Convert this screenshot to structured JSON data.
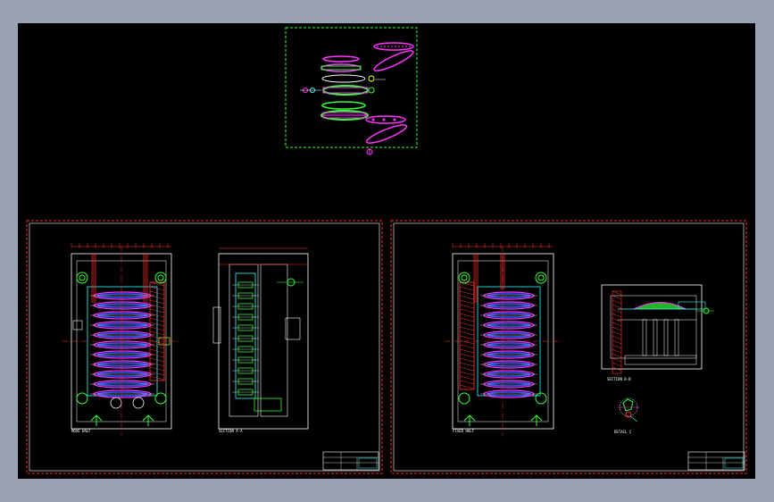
{
  "colors": {
    "background": "#000000",
    "frame": "#9aa3b1",
    "sheet_border": "#ff2a2a",
    "sheet_inner": "#ffffff",
    "part_magenta": "#ff33ff",
    "part_green": "#33ff33",
    "dim_red": "#ff3333",
    "line_white": "#ffffff",
    "line_blue": "#3355ff",
    "line_cyan": "#33ffff",
    "line_yellow": "#ffff33"
  },
  "labels": {
    "sheet1_view1": "MOVE HALF",
    "sheet1_view2": "SECTION A-A",
    "sheet2_view1": "FIXED HALF",
    "sheet2_view2": "SECTION B-B",
    "sheet2_detail": "DETAIL C"
  }
}
